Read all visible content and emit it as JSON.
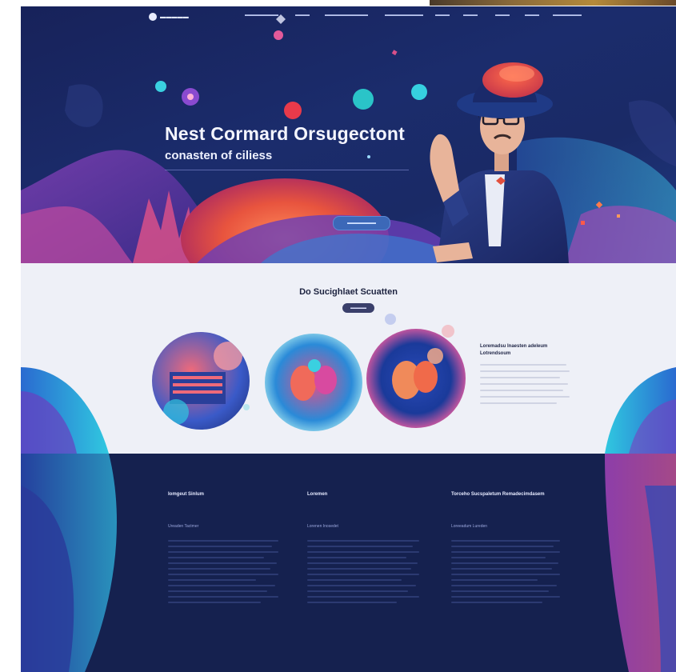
{
  "colors": {
    "hero_bg": "#17225a",
    "accent_blue": "#3c68b8",
    "accent_orange": "#f06a4a",
    "accent_pink": "#e24a8a",
    "accent_cyan": "#2ec4d9",
    "footer_bg": "#15214f",
    "feature_bg": "#eef0f7"
  },
  "header": {
    "logo_text": "▬▬▬▬▬",
    "nav": [
      "▬▬▬▬▬▬▬",
      "▬▬▬",
      "▬▬▬▬▬▬▬▬▬",
      "▬▬▬▬▬▬▬▬",
      "▬▬▬",
      "▬▬▬",
      "▬▬▬",
      "▬▬▬",
      "▬▬▬▬▬▬"
    ]
  },
  "hero": {
    "title": "Nest Cormard Orsugectont",
    "subtitle": "conasten of ciliess",
    "cta_label": "▬▬▬▬▬▬"
  },
  "feature": {
    "title": "Do Sucighlaet Scuatten",
    "badge": "▬▬▬▬",
    "side_title": "Loremadsu Inaesten adeleum Lotrendsoum"
  },
  "footer": {
    "columns": [
      {
        "heading": "Iomgeut Sinlum",
        "sub": "Ureaden Tactmer"
      },
      {
        "heading": "Loremen",
        "sub": "Lorenen Inosedet"
      },
      {
        "heading": "Torceho Sucspaletum Remadecimdasem",
        "sub": "Loreeadum Lureden"
      }
    ]
  }
}
